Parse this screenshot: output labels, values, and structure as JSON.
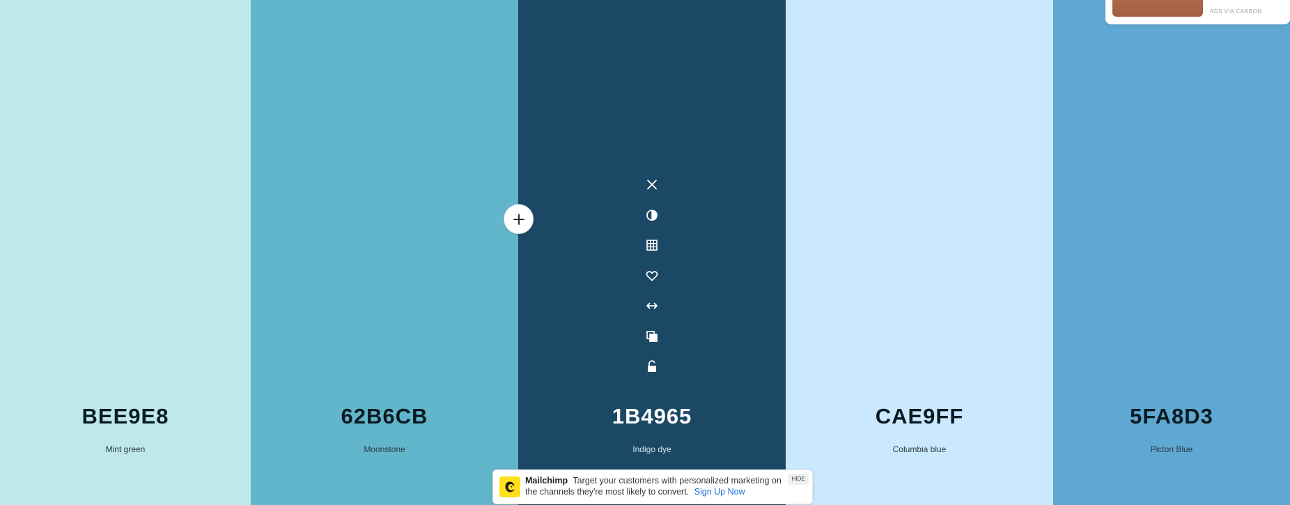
{
  "palette": {
    "swatches": [
      {
        "hex": "BEE9E8",
        "name": "Mint green",
        "color": "#BEE9E8",
        "text_tone": "dark"
      },
      {
        "hex": "62B6CB",
        "name": "Moonstone",
        "color": "#62B6CB",
        "text_tone": "dark"
      },
      {
        "hex": "1B4965",
        "name": "Indigo dye",
        "color": "#1B4965",
        "text_tone": "light"
      },
      {
        "hex": "CAE9FF",
        "name": "Columbia blue",
        "color": "#CAE9FF",
        "text_tone": "dark"
      },
      {
        "hex": "5FA8D3",
        "name": "Picton Blue",
        "color": "#5FA8D3",
        "text_tone": "dark"
      }
    ],
    "active_swatch_tools": [
      "close-icon",
      "contrast-icon",
      "shades-grid-icon",
      "heart-icon",
      "drag-arrows-icon",
      "copy-icon",
      "unlock-icon"
    ],
    "add_button_icon": "plus-icon"
  },
  "carbon_ad": {
    "label": "ADS VIA CARBON"
  },
  "bottom_ad": {
    "brand": "Mailchimp",
    "text": "Target your customers with personalized marketing on the channels they're most likely to convert.",
    "cta": "Sign Up Now",
    "hide_label": "HIDE",
    "logo_color": "#FFE01B"
  }
}
